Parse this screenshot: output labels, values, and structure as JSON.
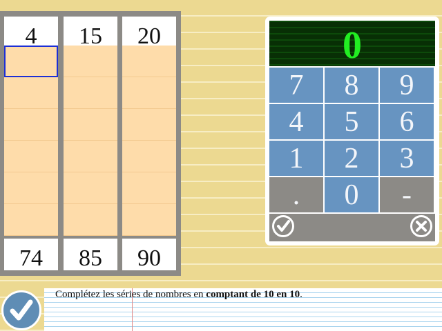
{
  "columns": [
    {
      "top": "4",
      "bottom": "74"
    },
    {
      "top": "15",
      "bottom": "85"
    },
    {
      "top": "20",
      "bottom": "90"
    }
  ],
  "keypad": {
    "display": "0",
    "keys": [
      "7",
      "8",
      "9",
      "4",
      "5",
      "6",
      "1",
      "2",
      "3",
      ".",
      "0",
      "-"
    ]
  },
  "instruction": {
    "prefix": "Complétez les séries de nombres en ",
    "bold": "comptant de 10 en 10",
    "suffix": "."
  },
  "icons": {
    "keypad_ok": "check-circle-icon",
    "keypad_cancel": "x-circle-icon",
    "validate": "check-circle-icon"
  },
  "colors": {
    "cell_empty": "#fedcaa",
    "key_blue": "#6794c1",
    "display_digit": "#22ee22",
    "selection": "#1c2fd6"
  }
}
